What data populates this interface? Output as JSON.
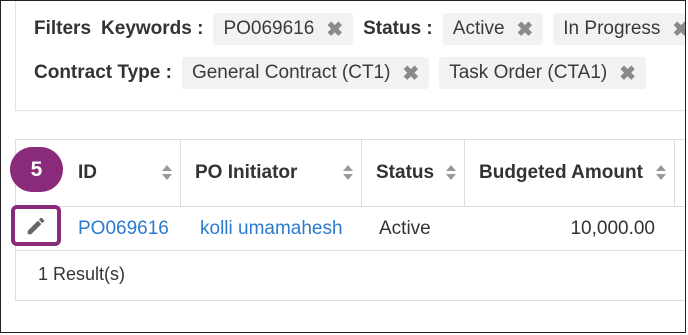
{
  "filters": {
    "heading": "Filters",
    "keywords": {
      "label": "Keywords :",
      "chips": [
        "PO069616"
      ]
    },
    "status": {
      "label": "Status :",
      "chips": [
        "Active",
        "In Progress"
      ]
    },
    "contract_type": {
      "label": "Contract Type :",
      "chips": [
        "General Contract (CT1)",
        "Task Order (CTA1)"
      ]
    },
    "remove_glyph": "✖"
  },
  "step_badge": "5",
  "table": {
    "columns": [
      "ID",
      "PO Initiator",
      "Status",
      "Budgeted Amount"
    ],
    "rows": [
      {
        "id": "PO069616",
        "initiator": "kolli umamahesh",
        "status": "Active",
        "amount": "10,000.00"
      }
    ],
    "result_count": "1 Result(s)"
  },
  "icons": {
    "edit": "pencil-icon",
    "sort": "sort-icon",
    "remove": "close-icon"
  },
  "colors": {
    "accent": "#8a2a7a",
    "link": "#2a7bd0",
    "chip_bg": "#f2f2f2",
    "border": "#dddddd"
  }
}
